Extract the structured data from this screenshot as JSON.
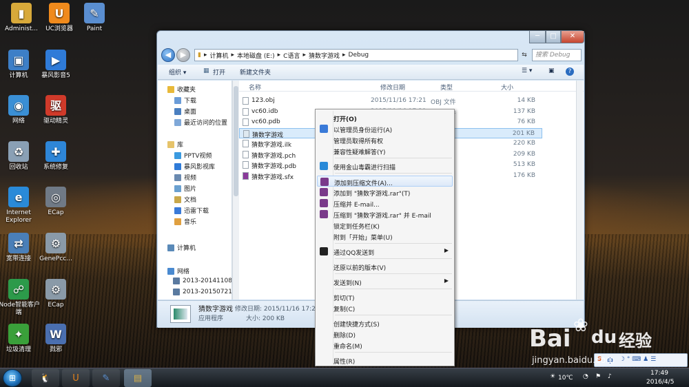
{
  "desktop_icons": [
    {
      "label": "Administ...",
      "icon": "user-folder-icon",
      "color": "#d8a93a"
    },
    {
      "label": "UC浏览器",
      "icon": "uc-browser-icon",
      "color": "#f08a1c"
    },
    {
      "label": "Paint",
      "icon": "paint-icon",
      "color": "#5a8ed0"
    },
    {
      "label": "计算机",
      "icon": "computer-icon",
      "color": "#3d7fc7"
    },
    {
      "label": "暴风影音5",
      "icon": "baofeng-icon",
      "color": "#2f7bd8"
    },
    {
      "label": "网络",
      "icon": "network-icon",
      "color": "#3a8fd5"
    },
    {
      "label": "驱动精灵",
      "icon": "driver-icon",
      "color": "#d03a2a"
    },
    {
      "label": "回收站",
      "icon": "recycle-bin-icon",
      "color": "#8aa0b5"
    },
    {
      "label": "系统修复",
      "icon": "repair-icon",
      "color": "#2e86d8"
    },
    {
      "label": "Internet Explorer",
      "icon": "ie-icon",
      "color": "#2a8ad8"
    },
    {
      "label": "ECap",
      "icon": "camera-icon",
      "color": "#707a86"
    },
    {
      "label": "宽带连接",
      "icon": "broadband-icon",
      "color": "#4a7fb8"
    },
    {
      "label": "GenePcc...",
      "icon": "gear-file-icon",
      "color": "#8a9aa8"
    },
    {
      "label": "iNode智能客户端",
      "icon": "inode-icon",
      "color": "#2c9a4a"
    },
    {
      "label": "ECap",
      "icon": "gear-file-icon",
      "color": "#8a9aa8"
    },
    {
      "label": "垃圾清理",
      "icon": "cleaner-icon",
      "color": "#3aa03a"
    },
    {
      "label": "戮邪",
      "icon": "document-icon",
      "color": "#4a6fb0"
    }
  ],
  "window": {
    "min": "─",
    "max": "□",
    "close": "✕",
    "address": [
      "计算机",
      "本地磁盘 (E:)",
      "C语言",
      "猜数字游戏",
      "Debug"
    ],
    "search_placeholder": "搜索 Debug",
    "toolbar": {
      "organize": "组织 ▾",
      "open": "打开",
      "new_folder": "新建文件夹"
    },
    "nav": [
      {
        "label": "收藏夹",
        "color": "#e8b93a"
      },
      {
        "label": "下载",
        "color": "#6a9cd8"
      },
      {
        "label": "桌面",
        "color": "#4a7fc0"
      },
      {
        "label": "最近访问的位置",
        "color": "#7fa8d8"
      },
      {
        "label": "库",
        "color": "#e6c36a"
      },
      {
        "label": "PPTV视频",
        "color": "#3a9ae0"
      },
      {
        "label": "暴风影视库",
        "color": "#2f7bd8"
      },
      {
        "label": "视频",
        "color": "#6a8ab0"
      },
      {
        "label": "图片",
        "color": "#6aa0d0"
      },
      {
        "label": "文档",
        "color": "#c9a84a"
      },
      {
        "label": "迅雷下载",
        "color": "#3a7ad8"
      },
      {
        "label": "音乐",
        "color": "#e0a040"
      },
      {
        "label": "计算机",
        "color": "#5a8ab8"
      },
      {
        "label": "网络",
        "color": "#4a8ad0"
      },
      {
        "label": "2013-20141108",
        "color": "#5a7aa0"
      },
      {
        "label": "2013-20150721",
        "color": "#5a7aa0"
      }
    ],
    "columns": {
      "name": "名称",
      "date": "修改日期",
      "type": "类型",
      "size": "大小"
    },
    "files": [
      {
        "name": "123.obj",
        "date": "2015/11/16 17:21",
        "type": "OBJ 文件",
        "size": "14 KB"
      },
      {
        "name": "vc60.idb",
        "date": "2015/11/16 17:21",
        "type": "IDB 文件",
        "size": "137 KB"
      },
      {
        "name": "vc60.pdb",
        "date": "",
        "type": "",
        "size": "76 KB"
      },
      {
        "name": "猜数字游戏",
        "date": "",
        "type": "程序",
        "size": "201 KB"
      },
      {
        "name": "猜数字游戏.ilk",
        "date": "",
        "type": "文件",
        "size": "220 KB"
      },
      {
        "name": "猜数字游戏.pch",
        "date": "",
        "type": "文件",
        "size": "209 KB"
      },
      {
        "name": "猜数字游戏.pdb",
        "date": "",
        "type": "文件",
        "size": "513 KB"
      },
      {
        "name": "猜数字游戏.sfx",
        "date": "",
        "type": "",
        "size": "176 KB"
      }
    ],
    "status": {
      "name": "猜数字游戏",
      "modified": "修改日期: 2015/11/16 17:21",
      "type": "应用程序",
      "size": "大小: 200 KB"
    }
  },
  "context_menu": [
    {
      "label": "打开(O)",
      "bold": true,
      "icon": ""
    },
    {
      "label": "以管理员身份运行(A)",
      "icon": "shield-icon"
    },
    {
      "label": "管理员取得所有权",
      "icon": ""
    },
    {
      "label": "兼容性疑难解答(Y)",
      "icon": ""
    },
    {
      "label": "使用金山毒霸进行扫描",
      "icon": "duba-icon"
    },
    {
      "label": "添加到压缩文件(A)...",
      "icon": "winrar-icon"
    },
    {
      "label": "添加到 \"猜数字游戏.rar\"(T)",
      "icon": "winrar-icon"
    },
    {
      "label": "压缩并 E-mail...",
      "icon": "winrar-icon"
    },
    {
      "label": "压缩到 \"猜数字游戏.rar\" 并 E-mail",
      "icon": "winrar-icon"
    },
    {
      "label": "锁定到任务栏(K)",
      "icon": ""
    },
    {
      "label": "附到「开始」菜单(U)",
      "icon": ""
    },
    {
      "label": "通过QQ发送到",
      "icon": "qq-icon",
      "arrow": "▶"
    },
    {
      "label": "还原以前的版本(V)",
      "icon": ""
    },
    {
      "label": "发送到(N)",
      "icon": "",
      "arrow": "▶"
    },
    {
      "label": "剪切(T)",
      "icon": ""
    },
    {
      "label": "复制(C)",
      "icon": ""
    },
    {
      "label": "创建快捷方式(S)",
      "icon": ""
    },
    {
      "label": "删除(D)",
      "icon": ""
    },
    {
      "label": "重命名(M)",
      "icon": ""
    },
    {
      "label": "属性(R)",
      "icon": ""
    }
  ],
  "taskbar": {
    "start": "⊞",
    "apps": [
      "qq-icon",
      "uc-browser-icon",
      "paint-icon",
      "explorer-icon"
    ],
    "temperature": "10℃",
    "time": "17:49",
    "date": "2016/4/5"
  },
  "ime": {
    "s": "S",
    "lang": "中",
    "symbols": "☽ ° ⌨ ♟ ☰"
  },
  "watermark": {
    "brand": "Bai",
    "paw": "du",
    "cn": "经验",
    "url": "jingyan.baidu.com"
  }
}
